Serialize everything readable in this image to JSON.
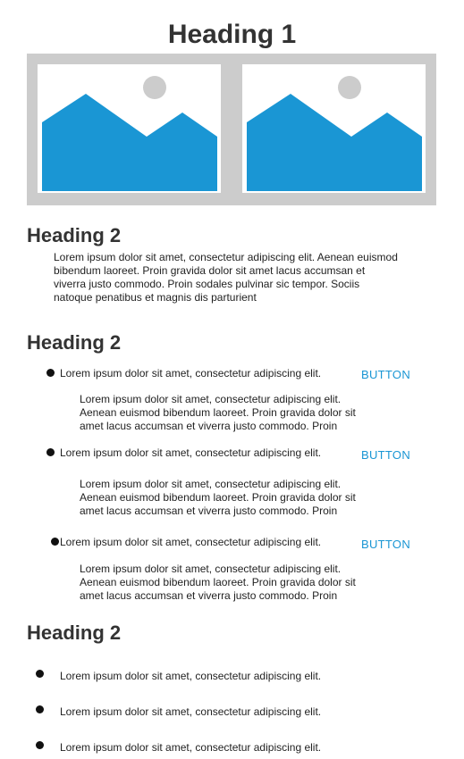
{
  "heading1": "Heading 1",
  "gallery": {
    "images": [
      {
        "icon": "image-placeholder-icon",
        "color": "#1a96d4"
      },
      {
        "icon": "image-placeholder-icon",
        "color": "#1a96d4"
      }
    ]
  },
  "section1": {
    "heading": "Heading 2",
    "paragraph_lines": [
      "Lorem ipsum dolor sit amet, consectetur adipiscing elit. Aenean euismod",
      "bibendum laoreet. Proin gravida dolor sit amet lacus accumsan et",
      "viverra justo commodo. Proin sodales pulvinar sic tempor. Sociis",
      "natoque penatibus et magnis dis parturient"
    ]
  },
  "section2": {
    "heading": "Heading 2",
    "items": [
      {
        "title": "Lorem ipsum dolor sit amet, consectetur adipiscing elit.",
        "button": "BUTTON",
        "detail_lines": [
          "Lorem ipsum dolor sit amet, consectetur adipiscing elit.",
          "Aenean euismod bibendum laoreet. Proin gravida dolor sit",
          "amet lacus accumsan et viverra justo commodo. Proin"
        ]
      },
      {
        "title": "Lorem ipsum dolor sit amet, consectetur adipiscing elit.",
        "button": "BUTTON",
        "detail_lines": [
          "Lorem ipsum dolor sit amet, consectetur adipiscing elit.",
          "Aenean euismod bibendum laoreet. Proin gravida dolor sit",
          "amet lacus accumsan et viverra justo commodo. Proin"
        ]
      },
      {
        "title": "Lorem ipsum dolor sit amet, consectetur adipiscing elit.",
        "button": "BUTTON",
        "detail_lines": [
          "Lorem ipsum dolor sit amet, consectetur adipiscing elit.",
          "Aenean euismod bibendum laoreet. Proin gravida dolor sit",
          "amet lacus accumsan et viverra justo commodo. Proin"
        ]
      }
    ]
  },
  "section3": {
    "heading": "Heading 2",
    "items": [
      "Lorem ipsum dolor sit amet, consectetur adipiscing elit.",
      "Lorem ipsum dolor sit amet, consectetur adipiscing elit.",
      "Lorem ipsum dolor sit amet, consectetur adipiscing elit."
    ]
  }
}
